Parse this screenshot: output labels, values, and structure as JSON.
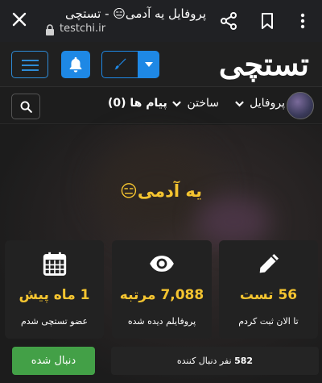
{
  "browser": {
    "title": "پروفایل یه آدمی😑 - تستچی",
    "url": "testchi.ir"
  },
  "header": {
    "logo": "تستچی"
  },
  "nav": {
    "profile_label": "پروفایل",
    "create_label": "ساختن",
    "messages_label": "پیام ها (0)"
  },
  "hero": {
    "username": "یه آدمی😑"
  },
  "stats": [
    {
      "icon": "pencil-icon",
      "value": "56 تست",
      "label": "تا الان ثبت کردم"
    },
    {
      "icon": "eye-icon",
      "value": "7,088 مرتبه",
      "label": "پروفایلم دیده شده"
    },
    {
      "icon": "calendar-icon",
      "value": "1 ماه پیش",
      "label": "عضو تستچی شدم"
    }
  ],
  "follow": {
    "button_label": "دنبال شده",
    "followers_count": "582",
    "followers_text": "نفر دنبال کننده"
  },
  "colors": {
    "accent_blue": "#1e88e5",
    "highlight_yellow": "#f4c430",
    "follow_green": "#43a047"
  }
}
